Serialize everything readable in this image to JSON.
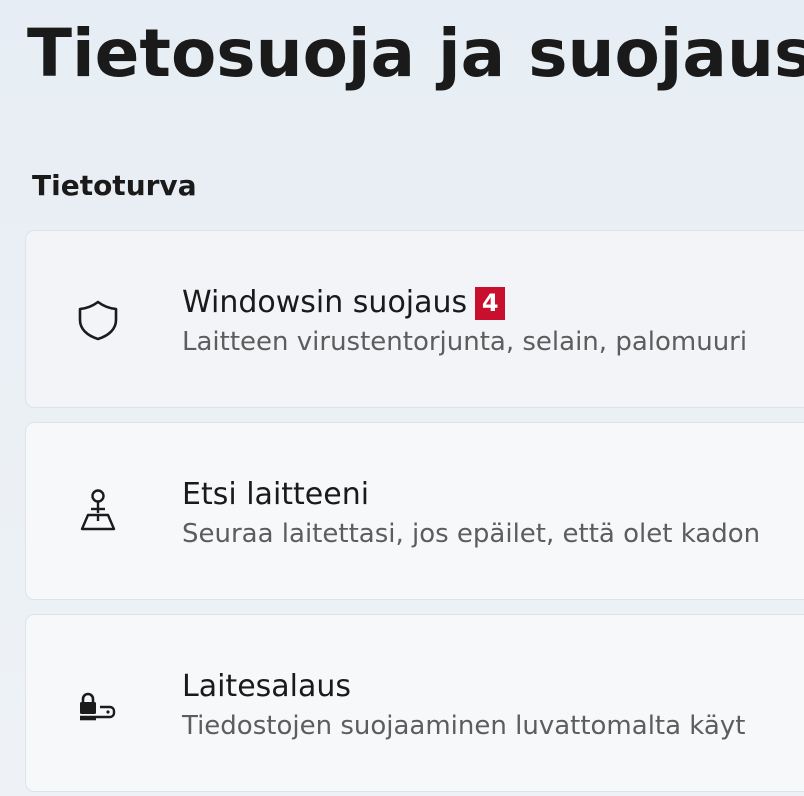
{
  "header": {
    "title": "Tietosuoja ja suojaus"
  },
  "section": {
    "title": "Tietoturva"
  },
  "items": [
    {
      "icon": "shield-icon",
      "title": "Windowsin suojaus",
      "badge": "4",
      "description": "Laitteen virustentorjunta, selain, palomuuri"
    },
    {
      "icon": "find-my-device-icon",
      "title": "Etsi laitteeni",
      "description": "Seuraa laitettasi, jos epäilet, että olet kadon"
    },
    {
      "icon": "device-encryption-icon",
      "title": "Laitesalaus",
      "description": "Tiedostojen suojaaminen luvattomalta käyt"
    }
  ],
  "colors": {
    "badge": "#c8102e",
    "background": "#e9eff5",
    "card": "#f6f8fa"
  }
}
